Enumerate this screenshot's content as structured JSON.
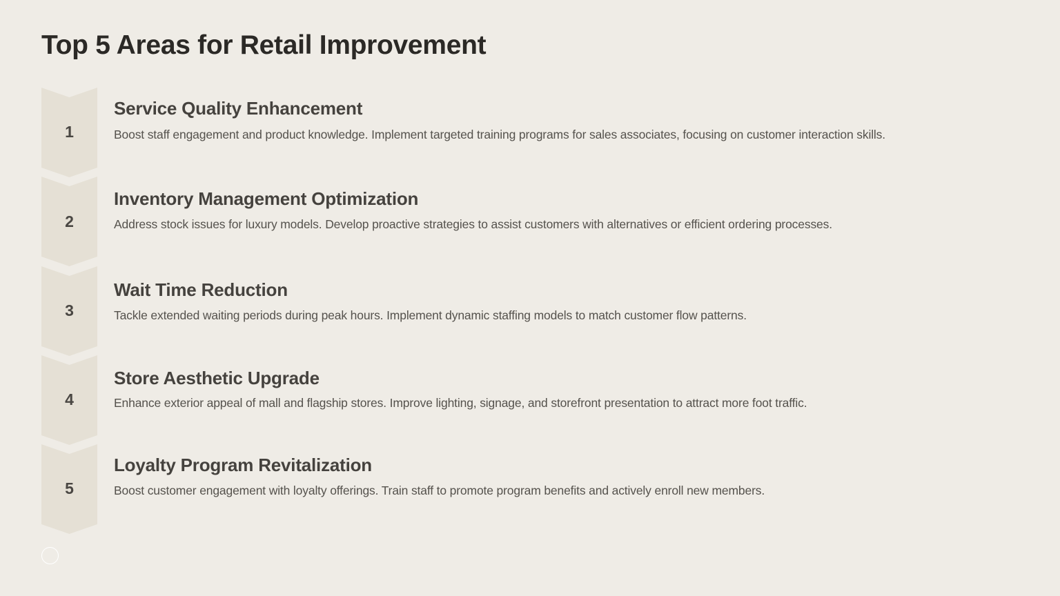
{
  "page": {
    "title": "Top 5 Areas for Retail Improvement"
  },
  "colors": {
    "background": "#efece6",
    "chevron_fill": "#e5e0d5",
    "heading": "#2b2926",
    "item_title": "#45423e",
    "body_text": "#55524d"
  },
  "items": [
    {
      "number": "1",
      "title": "Service Quality Enhancement",
      "description": "Boost staff engagement and product knowledge. Implement targeted training programs for sales associates, focusing on customer interaction skills."
    },
    {
      "number": "2",
      "title": "Inventory Management Optimization",
      "description": "Address stock issues for luxury models. Develop proactive strategies to assist customers with alternatives or efficient ordering processes."
    },
    {
      "number": "3",
      "title": "Wait Time Reduction",
      "description": "Tackle extended waiting periods during peak hours. Implement dynamic staffing models to match customer flow patterns."
    },
    {
      "number": "4",
      "title": "Store Aesthetic Upgrade",
      "description": "Enhance exterior appeal of mall and flagship stores. Improve lighting, signage, and storefront presentation to attract more foot traffic."
    },
    {
      "number": "5",
      "title": "Loyalty Program Revitalization",
      "description": "Boost customer engagement with loyalty offerings. Train staff to promote program benefits and actively enroll new members."
    }
  ],
  "icons": {
    "chevron": "chevron-down-shape",
    "page_indicator": "circle-outline-icon"
  }
}
